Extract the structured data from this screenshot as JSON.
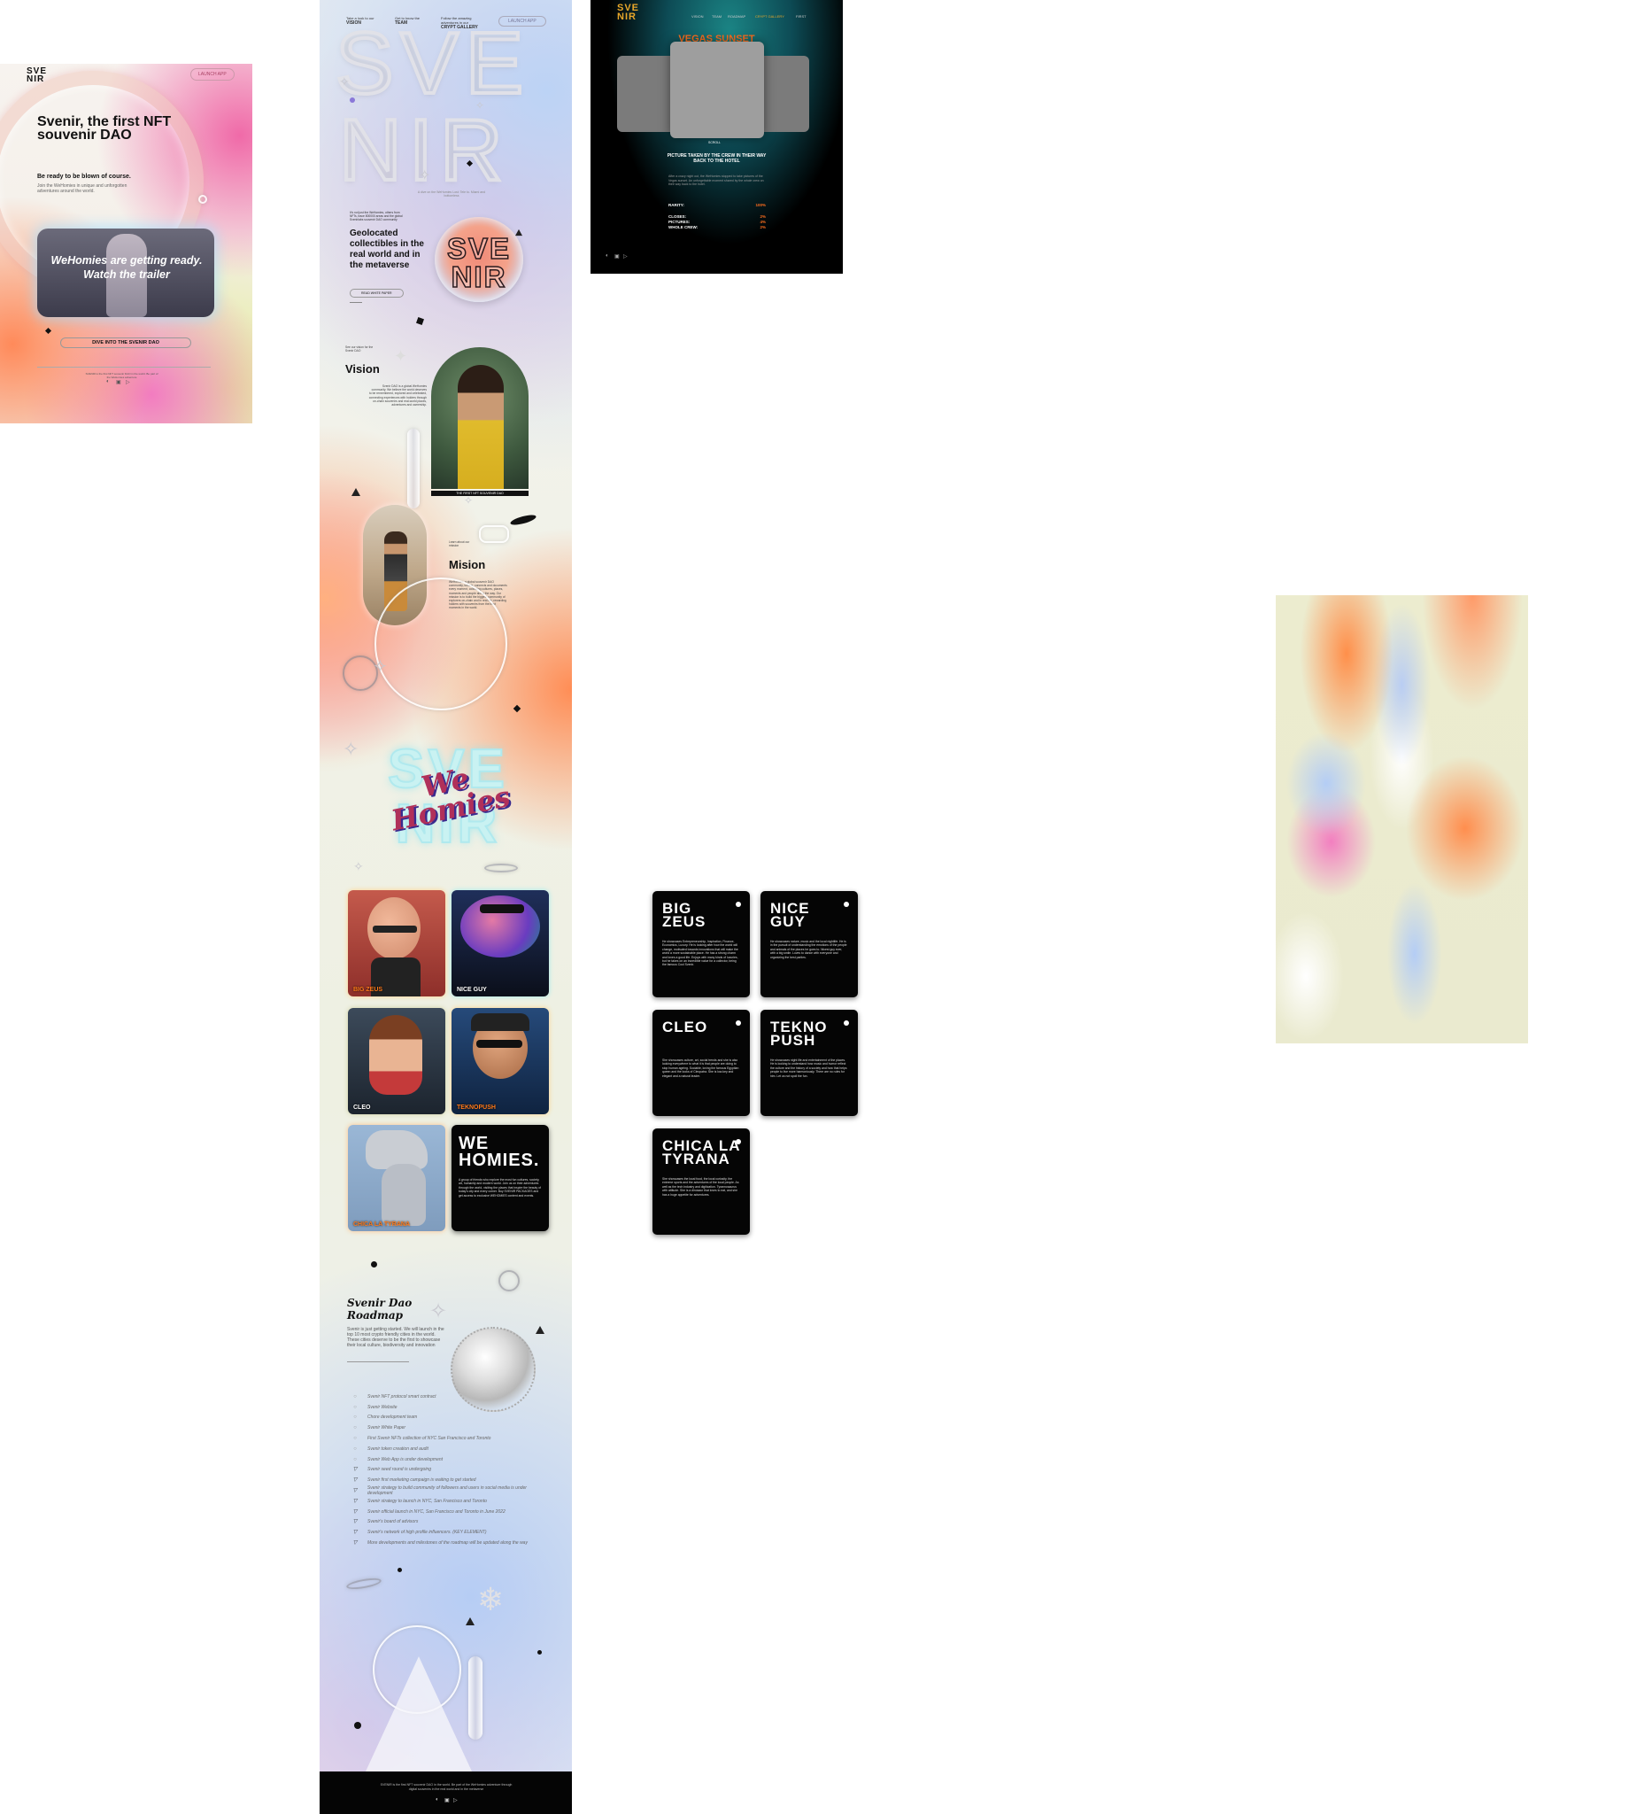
{
  "mobile": {
    "logo": "SVE\nNIR",
    "launch_label": "LAUNCH APP",
    "hero_title": "Svenir, the first NFT souvenir DAO",
    "hero_subtitle": "Be ready to be blown of course.",
    "hero_small": "Join the WeHomies in unique and unforgotten adventures around the world.",
    "video_text": "WeHomies are getting ready. Watch the trailer",
    "dive_label": "DIVE INTO THE SVENIR DAO",
    "footer_text": "SVENIR is the first NFT souvenir DAO in the world. Be part of the WeHomies adventure",
    "social": [
      "◐",
      "▣",
      "▷"
    ]
  },
  "landing": {
    "nav": [
      {
        "small": "Take a look to our",
        "label": "VISION"
      },
      {
        "small": "Get to know the",
        "label": "TEAM"
      },
      {
        "small": "Follow the amazing adventures in our",
        "label": "CRYPT GALLERY"
      }
    ],
    "launch_label": "LAUNCH APP",
    "big_word_top": "SVE",
    "big_word_bottom": "NIR",
    "tagline": "A dive on the WeHomies Lost: Tele to. Miami and bottomless",
    "intro_small": "It's not just the WeHomies, others from NFTs, trace 800000 areas and the global Svenirlabs souvenir DAO community",
    "geo_title": "Geolocated collectibles in the real world and in the metaverse",
    "read_more": "READ WHITE PAPER",
    "badge_text": "SVE\nNIR",
    "vision_small": "See our vision for the Svenir DAO",
    "vision_title": "Vision",
    "vision_text": "Svenir DAO is a global WeHomies community. We believe the world deserves to be remembered, explored and celebrated, connecting experiences with holders through on-chain souvenirs and real-world places, adventures and ownership.",
    "photo_caption": "THE FIRST NFT SOUVENIR DAO",
    "mision_small": "Learn about our mission",
    "mision_title": "Mision",
    "mision_text": "WeHomies, a global souvenir DAO community, travels, connects and documents every moment, collecting cultures, places, moments and people along the way. Our mission is to build the biggest community of explorers on-chain and in real life, rewarding holders with souvenirs from the best moments in the world.",
    "homies_bg": "SVE\nNIR",
    "homies_script": "We Homies",
    "characters": [
      {
        "name": "BIG ZEUS",
        "accent": "orange"
      },
      {
        "name": "NICE GUY",
        "accent": "white"
      },
      {
        "name": "CLEO",
        "accent": "white"
      },
      {
        "name": "TEKNOPUSH",
        "accent": "orange"
      },
      {
        "name": "CHICA LA TYRANA",
        "accent": "orange"
      }
    ],
    "wehomies_title": "WE\nHOMIES.",
    "wehomies_text": "A group of friends who explore the most fun cultures, society, art, humanity and modern world. Join us on their adventures through the world, visiting the places that inspire the beauty of today's city and every corner. Buy SVENIR PACKAGES and get access to exclusive WEHOMIES content and events.",
    "roadmap_title": "Svenir Dao Roadmap",
    "roadmap_text": "Svenir is just getting started. We will launch in the top 10 most crypto friendly cities in the world. These cities deserve to be the first to showcase their local culture, biodiversity and innovation",
    "roadmap": [
      {
        "label": "Svenir NFT protocol smart contract",
        "done": false
      },
      {
        "label": "Svenir Website",
        "done": false
      },
      {
        "label": "Chore development team",
        "done": false
      },
      {
        "label": "Svenir White Paper",
        "done": false
      },
      {
        "label": "First Svenir NFTs collection of NYC San Francisco and Toronto",
        "done": false
      },
      {
        "label": "Svenir token creation and audit",
        "done": false
      },
      {
        "label": "Svenir Web App is under development",
        "done": false
      },
      {
        "label": "Svenir seed round is undergoing",
        "done": true
      },
      {
        "label": "Svenir first marketing campaign is waiting to get started",
        "done": true
      },
      {
        "label": "Svenir strategy to build community of followers and users in social media is under development",
        "done": true
      },
      {
        "label": "Svenir strategy to launch in NYC, San Francisco and Toronto",
        "done": true
      },
      {
        "label": "Svenir official launch in NYC, San Francisco and Toronto in June 2022",
        "done": true
      },
      {
        "label": "Svenir's board of advisors",
        "done": true
      },
      {
        "label": "Svenir's network of high profile influencers. (KEY ELEMENT)",
        "done": true
      },
      {
        "label": "More developments and milestones of the roadmap will be updated along the way",
        "done": true
      }
    ],
    "footer_text": "SVENIR is the first NFT souvenir DAO in the world. Be part of the WeHomies adventure through digital souvenirs in the real world and in the metaverse",
    "social": [
      "◐",
      "▣",
      "▷"
    ]
  },
  "gallery": {
    "logo": "SVE\nNIR",
    "nav": [
      "VISION",
      "TEAM",
      "ROADMAP",
      "CRYPT GALLERY",
      "FIRST"
    ],
    "active_nav": "CRYPT GALLERY",
    "title": "VEGAS SUNSET",
    "scroll_label": "SCROLL",
    "picture_title": "PICTURE TAKEN BY THE CREW IN THEIR WAY BACK TO THE HOTEL",
    "picture_desc": "After a crazy night out, the WeHomies stopped to take pictures of the Vegas sunset. An unforgettable moment shared by the whole crew on their way back to the hotel.",
    "stats": [
      {
        "label": "RARITY:",
        "value": "100%"
      },
      {
        "label": "CLOSES:",
        "value": "2%"
      },
      {
        "label": "PICTURES:",
        "value": "4%"
      },
      {
        "label": "WHOLE CREW:",
        "value": "2%"
      }
    ],
    "social": [
      "◐",
      "▣",
      "▷"
    ]
  },
  "character_cards": [
    {
      "name": "BIG\nZEUS",
      "desc": "He showcases Entrepreneurship, Inspiration, Finance, Economics, Luxury. He is looking after how the world will change, motivated towards innovations that will make the world a more sustainable place. He has a strong charm and loves a good life. Enjoys with many kinds of luxuries, but he takes on an incredible value for a collector, being the famous Cool Svenir."
    },
    {
      "name": "NICE\nGUY",
      "desc": "He showcases nature, music and the local nightlife. He is in the pursuit of understanding the emotions of the people and animals of the places he goes to. Nicest guy ever, with a big smile. Loves to dance with everyone and organizing the best parties."
    },
    {
      "name": "CLEO",
      "desc": "She showcases culture, art, social trends and she is also looking everywhere to what it is that people are doing to stop human ageing. Sociable, loving the famous Egyptian queen and the looks of Cleopatra. She is low-key and elegant and a natural leader."
    },
    {
      "name": "TEKNO\nPUSH",
      "desc": "He showcases night life and entertainment of the places. He is looking to understand how music and humor reflect the culture and the history of a society and how that helps people to live more harmoniously. There are no rules for him. Let us not spoil the fun."
    },
    {
      "name": "CHICA LA\nTYRANA",
      "desc": "She showcases the local food, the local curiosity, the extreme sports and the adventures of the local people. As well as the tech industry and digitization. Tyrannosaurus with attitude. She is a dinosaur that loves to eat, and she has a huge appetite for adventures."
    }
  ]
}
